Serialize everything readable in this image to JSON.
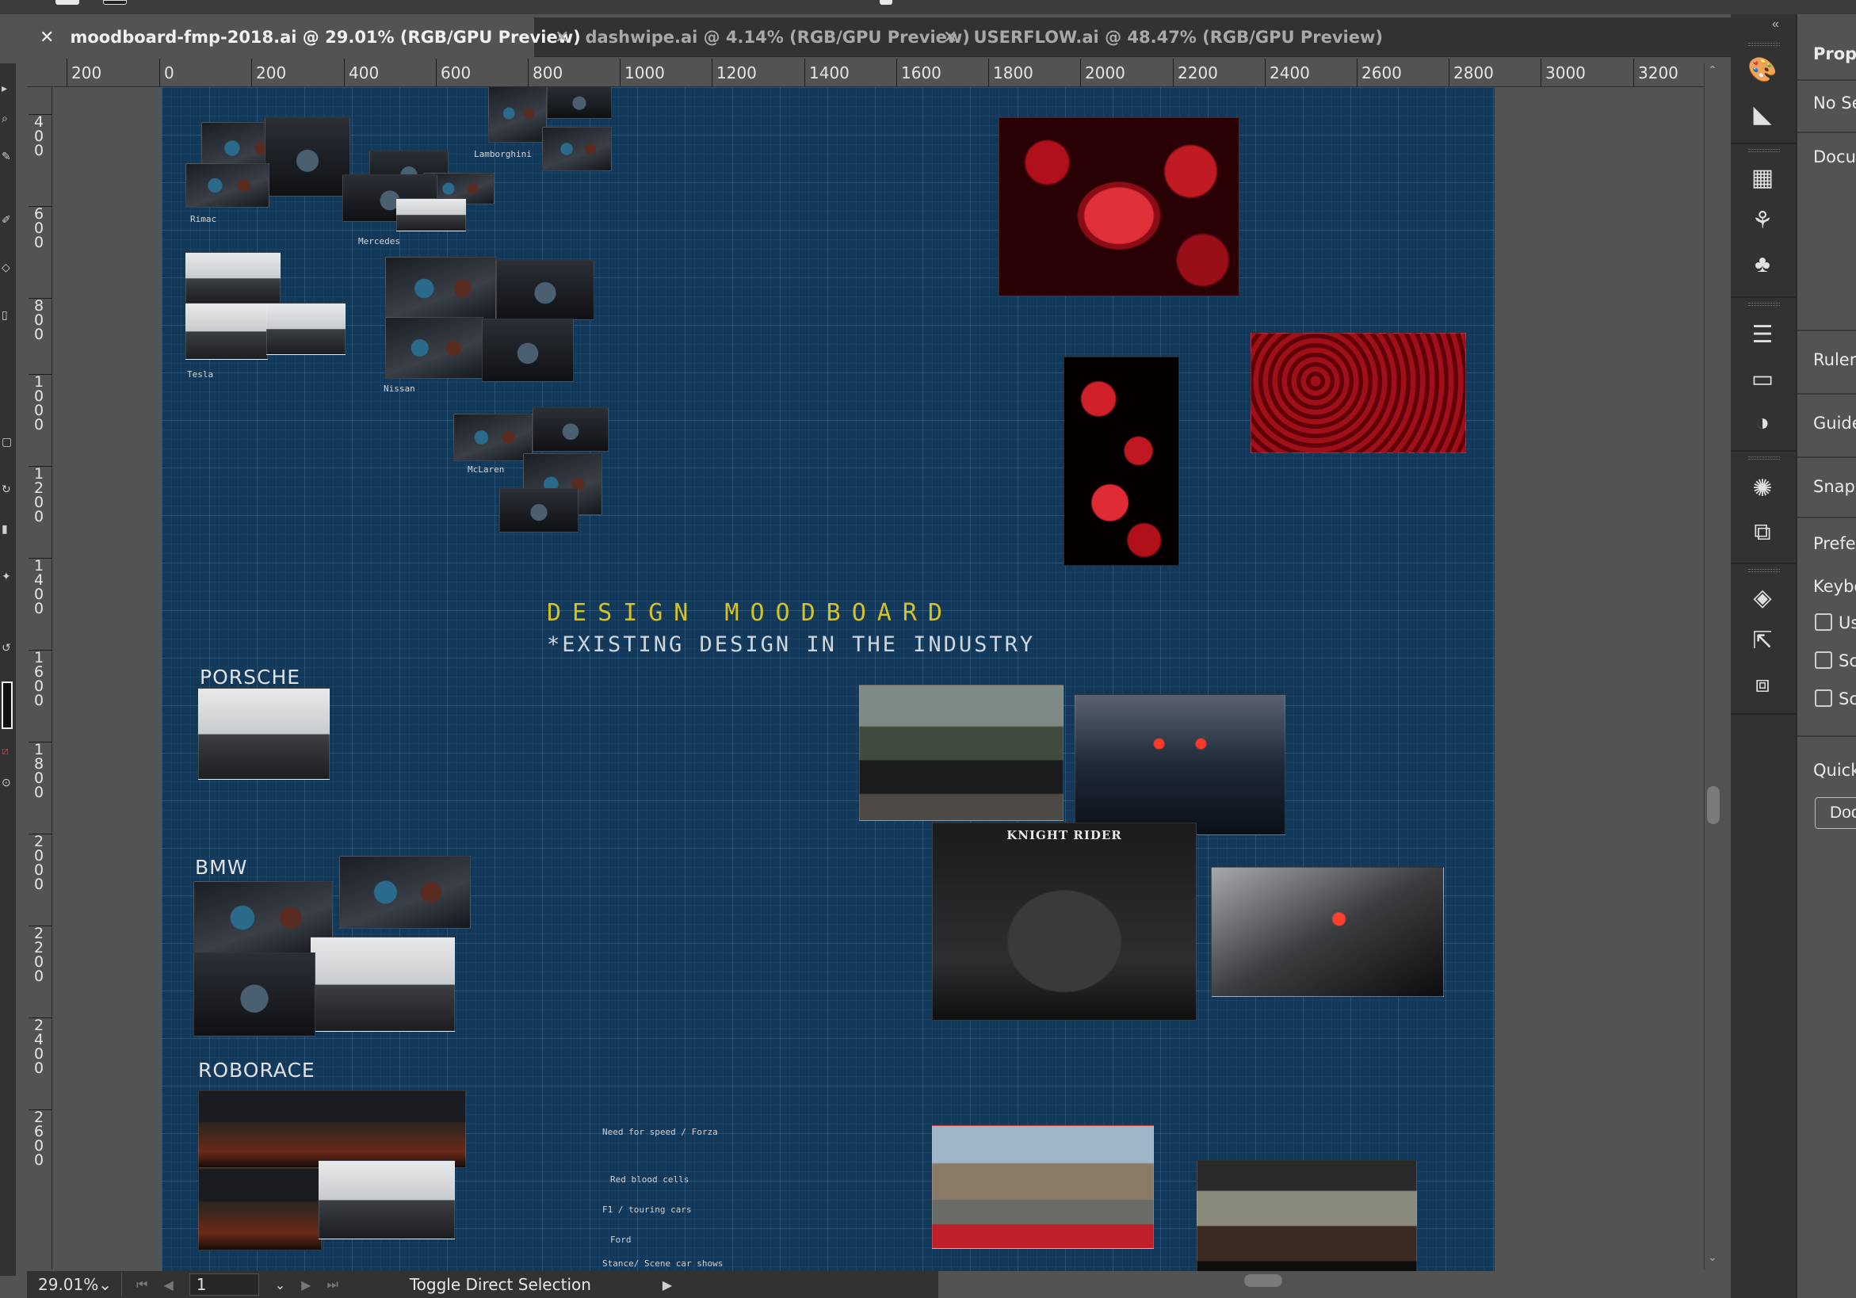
{
  "tabs": [
    {
      "label": "moodboard-fmp-2018.ai @ 29.01% (RGB/GPU Preview)",
      "close": "✕",
      "active": true
    },
    {
      "label": "dashwipe.ai @ 4.14% (RGB/GPU Preview)",
      "close": "✕",
      "active": false
    },
    {
      "label": "USERFLOW.ai @ 48.47% (RGB/GPU Preview)",
      "close": "✕",
      "active": false
    }
  ],
  "ruler_h": [
    "200",
    "0",
    "200",
    "400",
    "600",
    "800",
    "1000",
    "1200",
    "1400",
    "1600",
    "1800",
    "2000",
    "2200",
    "2400",
    "2600",
    "2800",
    "3000",
    "3200"
  ],
  "ruler_v": [
    "400",
    "600",
    "800",
    "1000",
    "1200",
    "1400",
    "1600",
    "1800",
    "2000",
    "2200",
    "2400",
    "2600"
  ],
  "artboard": {
    "title": "DESIGN MOODBOARD",
    "subtitle": "*EXISTING DESIGN IN THE INDUSTRY",
    "small_labels": {
      "rimac": "Rimac",
      "mercedes": "Mercedes",
      "lamborghini": "Lamborghini",
      "tesla": "Tesla",
      "nissan": "Nissan",
      "mclaren": "McLaren"
    },
    "brand_labels": {
      "porsche": "PORSCHE",
      "bmw": "BMW",
      "roborace": "ROBORACE"
    },
    "poster_title": "KNIGHT RIDER",
    "notes": [
      "Need for speed / Forza",
      "Red blood cells",
      "F1 / touring cars",
      "Ford",
      "Stance/ Scene car shows"
    ]
  },
  "statusbar": {
    "zoom": "29.01%",
    "page": "1",
    "tool": "Toggle Direct Selection"
  },
  "properties_panel": {
    "title": "Prope",
    "no_selection": "No Se",
    "document": "Docur",
    "ruler": "Ruler",
    "guides": "Guide",
    "snap": "Snap",
    "preferences": "Prefer",
    "keyboard": "Keybo",
    "check1": "Us",
    "check2": "Sc",
    "check3": "Sc",
    "quick": "Quick",
    "doc_button": "Doc"
  },
  "icons": {
    "collapse": "double-chevron-left-icon",
    "dock": [
      "color-palette-icon",
      "gradient-icon",
      "swatches-icon",
      "brushes-icon",
      "symbols-icon",
      "stroke-icon",
      "gradient-panel-icon",
      "transparency-icon",
      "appearance-icon",
      "transform-icon",
      "layers-icon",
      "asset-export-icon",
      "artboards-icon"
    ]
  }
}
